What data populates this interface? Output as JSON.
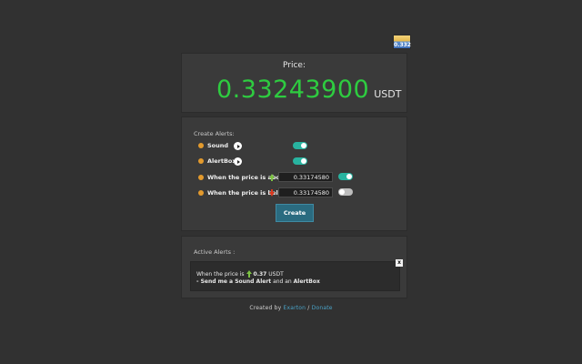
{
  "extension_icon": {
    "name": "extension-icon",
    "text": "0.332"
  },
  "price_panel": {
    "label": "Price:",
    "value": "0.33243900",
    "unit": "USDT",
    "value_color": "#2ecc40"
  },
  "create_alerts": {
    "title": "Create Alerts:",
    "sound_label": "Sound",
    "sound_toggle": "on",
    "alertbox_label": "AlertBox",
    "alertbox_toggle": "on",
    "above_label": "When the price is above:",
    "above_value": "0.33174580",
    "above_toggle": "on",
    "below_label": "When the price is below:",
    "below_value": "0.33174580",
    "below_toggle": "off",
    "create_label": "Create"
  },
  "active_alerts": {
    "title": "Active Alerts :",
    "items": [
      {
        "prefix": "When the price is",
        "direction": "up",
        "price": "0.37",
        "unit": "USDT",
        "line2_a": "- Send me a ",
        "line2_b": "Sound Alert",
        "line2_c": " and an ",
        "line2_d": "AlertBox",
        "close": "x"
      }
    ]
  },
  "footer": {
    "created_by": "Created by",
    "author": "Exarton",
    "separator": "/",
    "donate": "Donate"
  },
  "colors": {
    "background": "#313131",
    "panel": "#3a3a3a",
    "toggle_on": "#28b3a0",
    "toggle_off": "#bdbdbd",
    "bullet": "#e39a2d",
    "button": "#2a6b80",
    "link": "#4aa3c8",
    "arrow_up": "#7cc242",
    "arrow_down": "#d9391f"
  }
}
